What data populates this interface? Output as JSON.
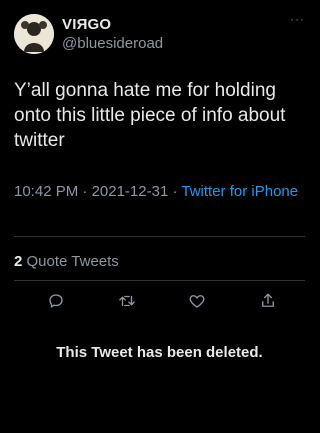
{
  "tweet": {
    "author": {
      "display_name": "VIЯGO",
      "handle": "@bluesideroad",
      "avatar_icon": "avatar-photo"
    },
    "more_label": "···",
    "text": "Y’all gonna hate me for holding onto this little piece of info about twitter",
    "time": "10:42 PM",
    "date": "2021-12-31",
    "separator": "·",
    "source": "Twitter for iPhone",
    "quote_count": "2",
    "quote_label": "Quote Tweets",
    "actions": [
      {
        "icon": "reply-icon"
      },
      {
        "icon": "retweet-icon"
      },
      {
        "icon": "like-icon"
      },
      {
        "icon": "share-icon"
      }
    ],
    "deleted_notice": "This Tweet has been deleted."
  },
  "colors": {
    "background": "#000000",
    "text": "#e7e9ea",
    "secondary": "#8b98a5",
    "link": "#1d9bf0",
    "divider": "#2f3336"
  }
}
